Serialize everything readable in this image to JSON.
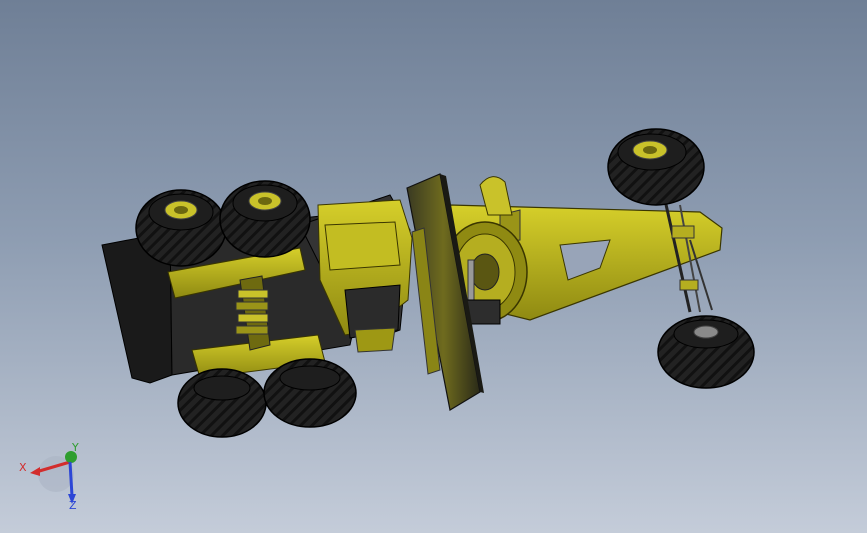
{
  "viewport": {
    "background_top": "#6f7f96",
    "background_bottom": "#c4ccd9"
  },
  "model": {
    "body_color": "#b8b21a",
    "tire_color": "#1f1f1f",
    "hub_color": "#c9c22a"
  },
  "triad": {
    "x_label": "X",
    "y_label": "Y",
    "z_label": "Z",
    "x_color": "#d22d2d",
    "y_color": "#2f9e2f",
    "z_color": "#2c46d6"
  }
}
